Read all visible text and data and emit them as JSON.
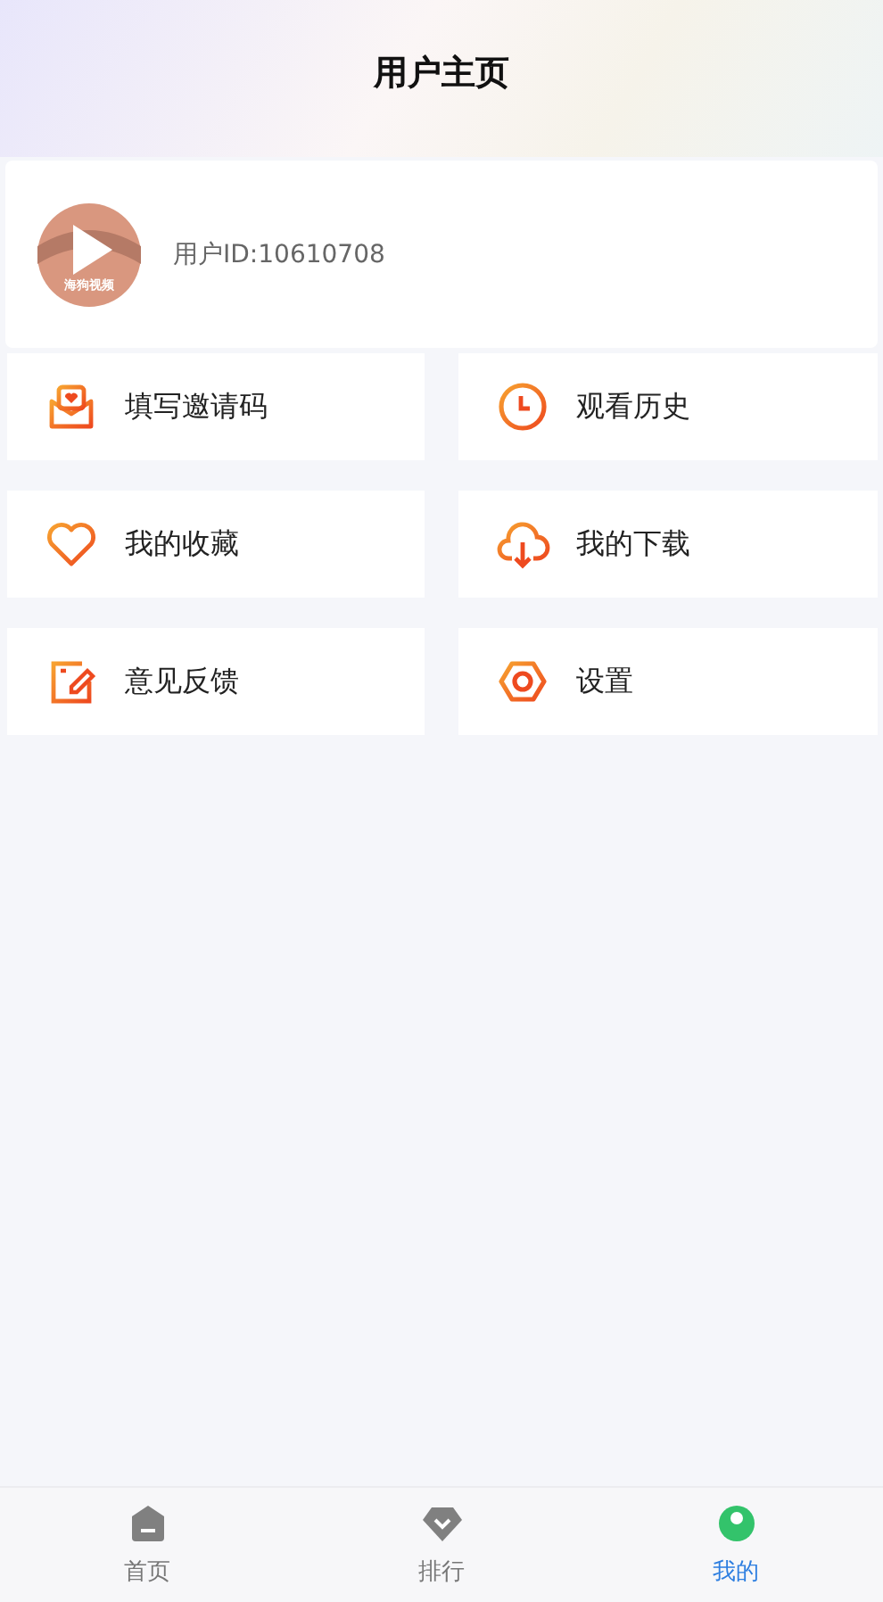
{
  "header": {
    "title": "用户主页"
  },
  "profile": {
    "avatar_text": "海狗视频",
    "user_id": "用户ID:10610708"
  },
  "menu": [
    {
      "kind": "invite",
      "label": "填写邀请码"
    },
    {
      "kind": "history",
      "label": "观看历史"
    },
    {
      "kind": "favorite",
      "label": "我的收藏"
    },
    {
      "kind": "download",
      "label": "我的下载"
    },
    {
      "kind": "feedback",
      "label": "意见反馈"
    },
    {
      "kind": "settings",
      "label": "设置"
    }
  ],
  "tabbar": [
    {
      "kind": "home",
      "label": "首页",
      "selected": false
    },
    {
      "kind": "rank",
      "label": "排行",
      "selected": false
    },
    {
      "kind": "mine",
      "label": "我的",
      "selected": true
    }
  ]
}
